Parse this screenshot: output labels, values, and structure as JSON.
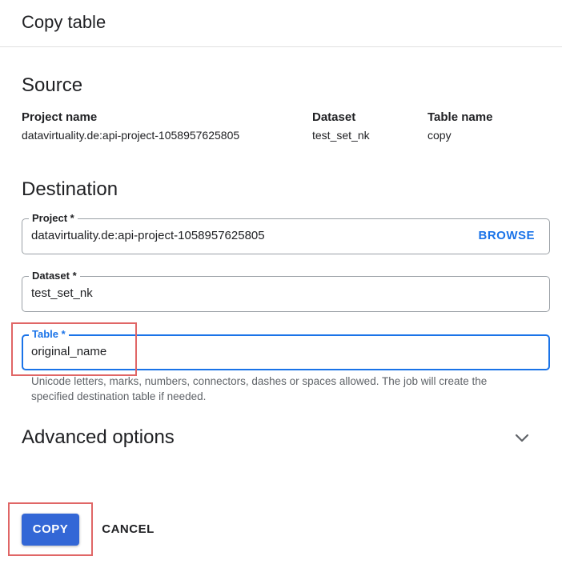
{
  "dialog": {
    "title": "Copy table"
  },
  "source": {
    "heading": "Source",
    "project_label": "Project name",
    "project_value": "datavirtuality.de:api-project-1058957625805",
    "dataset_label": "Dataset",
    "dataset_value": "test_set_nk",
    "table_label": "Table name",
    "table_value": "copy"
  },
  "destination": {
    "heading": "Destination",
    "project": {
      "label": "Project *",
      "value": "datavirtuality.de:api-project-1058957625805",
      "browse_label": "BROWSE"
    },
    "dataset": {
      "label": "Dataset *",
      "value": "test_set_nk"
    },
    "table": {
      "label": "Table *",
      "value": "original_name",
      "hint": "Unicode letters, marks, numbers, connectors, dashes or spaces allowed. The job will create the specified destination table if needed."
    }
  },
  "advanced": {
    "label": "Advanced options",
    "icon": "chevron-down-icon"
  },
  "actions": {
    "copy_label": "COPY",
    "cancel_label": "CANCEL"
  },
  "colors": {
    "accent": "#1a73e8",
    "primary_button": "#3367d6",
    "highlight_box": "#e06666"
  }
}
